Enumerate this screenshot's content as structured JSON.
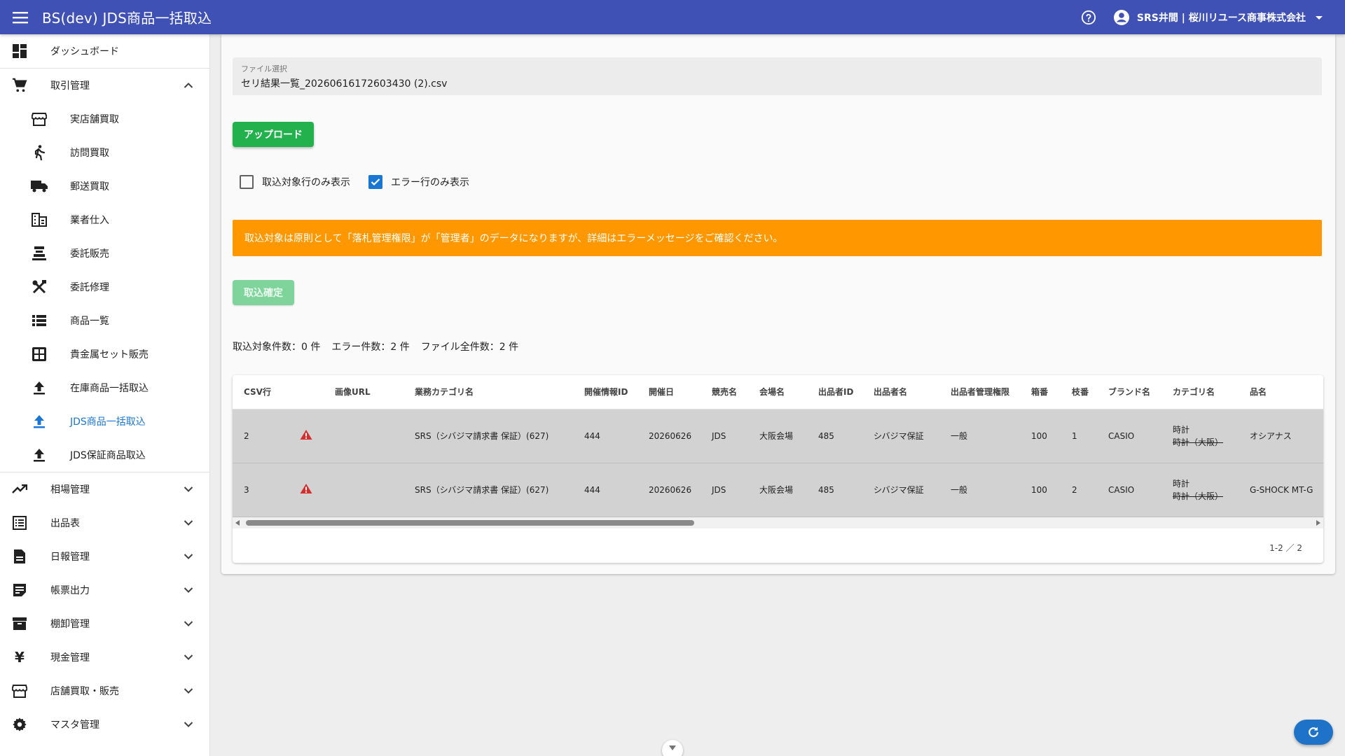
{
  "app": {
    "title": "BS(dev) JDS商品一括取込",
    "user": "SRS井間 | 桜川リユース商事株式会社",
    "icons": {
      "menu": "menu-icon",
      "help": "help-circle-icon",
      "user": "account-circle-icon"
    }
  },
  "sidebar": {
    "dashboard": "ダッシュボード",
    "trade": "取引管理",
    "sub": [
      "実店舗買取",
      "訪問買取",
      "郵送買取",
      "業者仕入",
      "委託販売",
      "委託修理",
      "商品一覧",
      "貴金属セット販売",
      "在庫商品一括取込",
      "JDS商品一括取込",
      "JDS保証商品取込"
    ],
    "sections": [
      "相場管理",
      "出品表",
      "日報管理",
      "帳票出力",
      "棚卸管理",
      "現金管理",
      "店舗買取・販売",
      "マスタ管理"
    ]
  },
  "main": {
    "file_label": "ファイル選択",
    "file_value": "セリ結果一覧_20260616172603430 (2).csv",
    "upload_label": "アップロード",
    "check_target_only": "取込対象行のみ表示",
    "check_error_only": "エラー行のみ表示",
    "alert_text": "取込対象は原則として「落札管理権限」が「管理者」のデータになりますが、詳細はエラーメッセージをご確認ください。",
    "confirm_label": "取込確定",
    "counts": {
      "target": "取込対象件数：0 件",
      "error": "エラー件数：2 件",
      "total": "ファイル全件数：2 件"
    }
  },
  "table": {
    "headers": [
      "CSV行",
      "",
      "画像URL",
      "業務カテゴリ名",
      "開催情報ID",
      "開催日",
      "競売名",
      "会場名",
      "出品者ID",
      "出品者名",
      "出品者管理権限",
      "箱番",
      "枝番",
      "ブランド名",
      "カテゴリ名",
      "品名"
    ],
    "rows": [
      [
        "2",
        "",
        "",
        "SRS（シバジマ請求書 保証）(627)",
        "444",
        "20260626",
        "JDS",
        "大阪会場",
        "485",
        "シバジマ保証",
        "一般",
        "100",
        "1",
        "CASIO",
        "時計",
        "時計（大阪）",
        "オシアナス"
      ],
      [
        "3",
        "",
        "",
        "SRS（シバジマ請求書 保証）(627)",
        "444",
        "20260626",
        "JDS",
        "大阪会場",
        "485",
        "シバジマ保証",
        "一般",
        "100",
        "2",
        "CASIO",
        "時計",
        "時計（大阪）",
        "G-SHOCK MT-G"
      ]
    ],
    "pager": "1-2 ／ 2"
  },
  "colors": {
    "appbar": "#3f51b5",
    "upload": "#22b14c",
    "alert": "#ff9800",
    "active_nav": "#1976d2",
    "error_icon": "#d32f2f"
  }
}
